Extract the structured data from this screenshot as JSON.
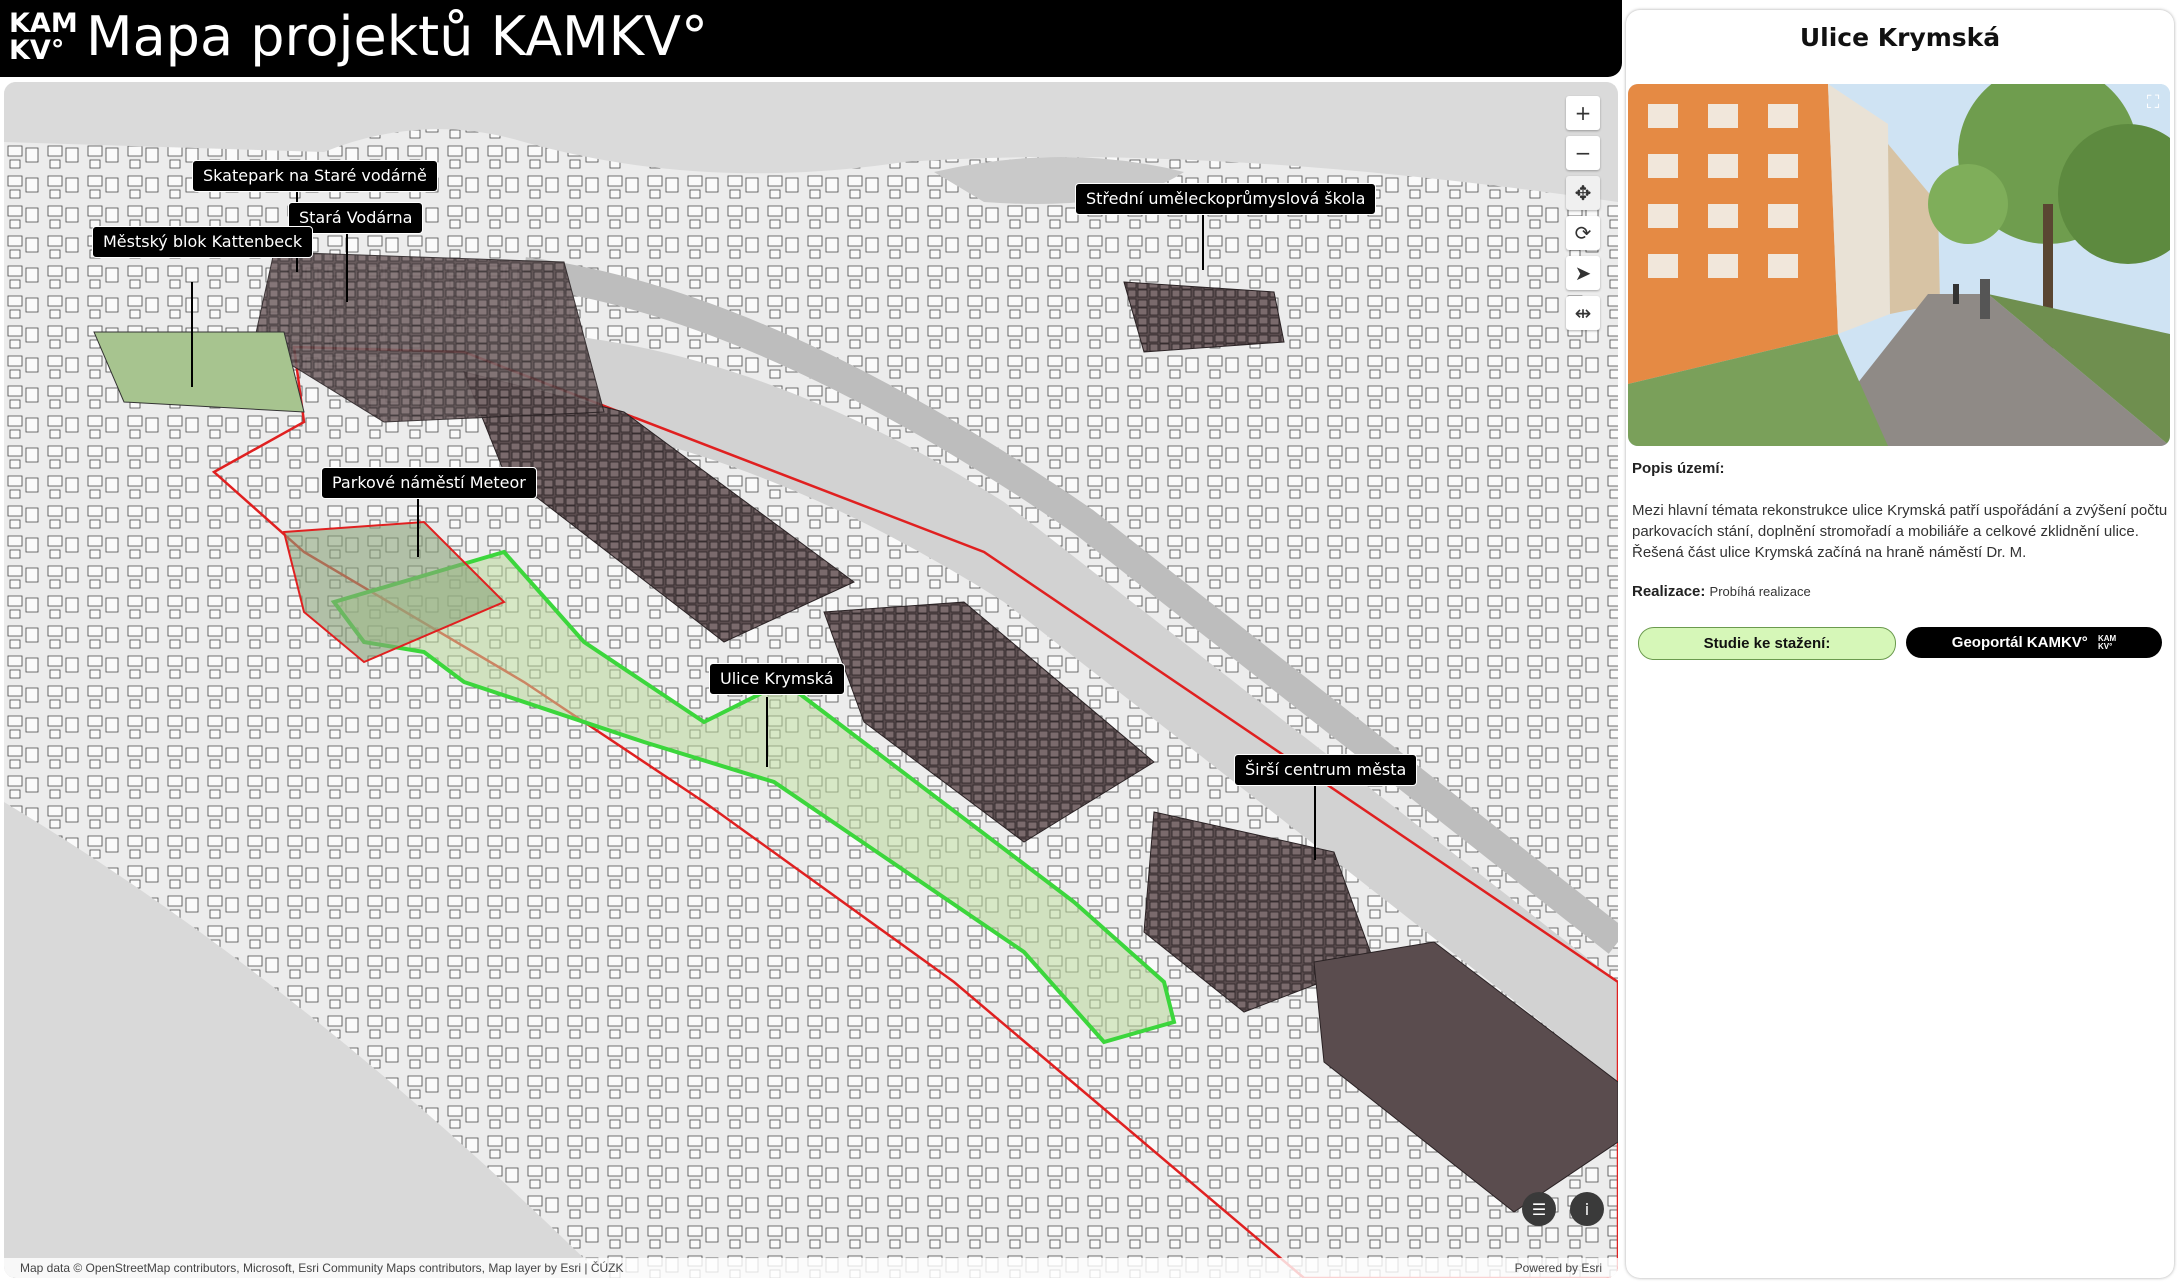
{
  "header": {
    "logo_line1": "KAM",
    "logo_line2": "KV°",
    "title": "Mapa projektů KAMKV°"
  },
  "map": {
    "labels": [
      {
        "text": "Skatepark na Staré vodárně"
      },
      {
        "text": "Stará Vodárna"
      },
      {
        "text": "Městský blok Kattenbeck"
      },
      {
        "text": "Střední uměleckoprůmyslová škola"
      },
      {
        "text": "Parkové náměstí Meteor"
      },
      {
        "text": "Ulice Krymská"
      },
      {
        "text": "Širší centrum města"
      }
    ],
    "tools": {
      "zoom_in": "+",
      "zoom_out": "−",
      "pan": "✥",
      "rotate": "⟳",
      "compass": "➤",
      "measure": "⇹"
    },
    "bottom_tools": {
      "legend": "☰",
      "info": "i"
    },
    "attribution_left": "Map data © OpenStreetMap contributors, Microsoft, Esri Community Maps contributors, Map layer by Esri | ČÚZK",
    "attribution_right": "Powered by Esri"
  },
  "panel": {
    "title": "Ulice Krymská",
    "description_label": "Popis území:",
    "description": "Mezi hlavní témata rekonstrukce ulice Krymská patří uspořádání a zvýšení počtu parkovacích stání, doplnění stromořadí a mobiliáře a celkové zklidnění ulice. Řešená část ulice Krymská začíná na hraně náměstí Dr. M.",
    "realization_label": "Realizace:",
    "realization_value": "Probíhá realizace",
    "button_studie": "Studie ke stažení:",
    "button_geoportal": "Geoportál KAMKV°",
    "geoportal_logo_line1": "KAM",
    "geoportal_logo_line2": "KV°"
  },
  "colors": {
    "header_bg": "#000000",
    "boundary_red": "#e02020",
    "highlight_green": "#3cd63c",
    "studie_button_bg": "#d6f7b8",
    "geoportal_button_bg": "#000000"
  }
}
